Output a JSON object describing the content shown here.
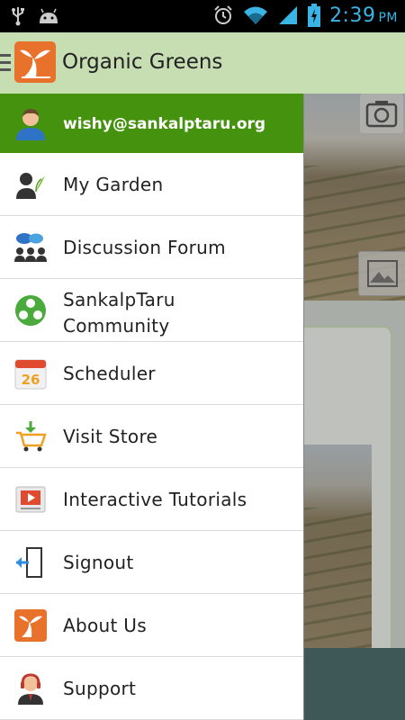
{
  "status_bar": {
    "time": "2:39",
    "ampm": "PM"
  },
  "app_bar": {
    "title": "Organic Greens"
  },
  "drawer": {
    "account_email": "wishy@sankalptaru.org",
    "items": [
      {
        "label": "My Garden",
        "icon": "gardener-icon"
      },
      {
        "label": "Discussion Forum",
        "icon": "forum-icon"
      },
      {
        "label": "SankalpTaru\nCommunity",
        "icon": "community-icon"
      },
      {
        "label": "Scheduler",
        "icon": "calendar-icon"
      },
      {
        "label": "Visit Store",
        "icon": "cart-icon"
      },
      {
        "label": "Interactive Tutorials",
        "icon": "video-icon"
      },
      {
        "label": "Signout",
        "icon": "signout-icon"
      },
      {
        "label": "About Us",
        "icon": "logo-icon"
      },
      {
        "label": "Support",
        "icon": "support-icon"
      }
    ],
    "calendar_day": "26"
  },
  "colors": {
    "accent_green": "#45920f",
    "app_bar": "#c7ddb2",
    "status_blue": "#3ab4e4",
    "logo_orange": "#e8712b"
  }
}
